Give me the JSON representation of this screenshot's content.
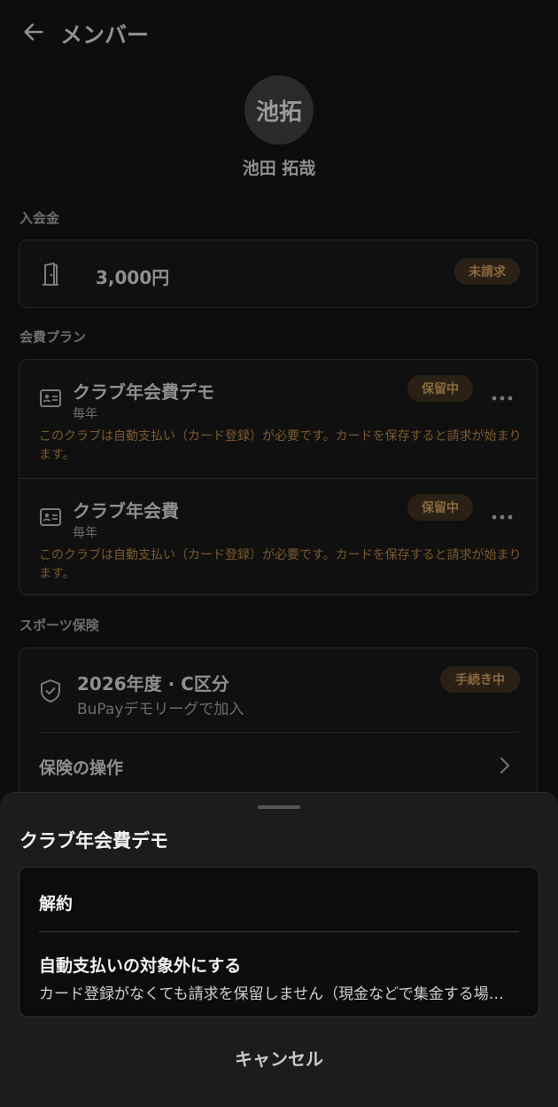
{
  "header": {
    "title": "メンバー"
  },
  "member": {
    "avatar_text": "池拓",
    "name": "池田 拓哉"
  },
  "entry_fee": {
    "label": "入会金",
    "amount": "3,000円",
    "status": "未請求"
  },
  "plans": {
    "label": "会費プラン",
    "items": [
      {
        "name": "クラブ年会費デモ",
        "period": "毎年",
        "status": "保留中",
        "note": "このクラブは自動支払い（カード登録）が必要です。カードを保存すると請求が始まります。"
      },
      {
        "name": "クラブ年会費",
        "period": "毎年",
        "status": "保留中",
        "note": "このクラブは自動支払い（カード登録）が必要です。カードを保存すると請求が始まります。"
      }
    ]
  },
  "insurance": {
    "label": "スポーツ保険",
    "name": "2026年度 · C区分",
    "sub": "BuPayデモリーグで加入",
    "status": "手続き中",
    "operations_label": "保険の操作"
  },
  "sheet": {
    "title": "クラブ年会費デモ",
    "option1": "解約",
    "option2": "自動支払いの対象外にする",
    "option2_sub": "カード登録がなくても請求を保留しません（現金などで集金する場合）",
    "cancel": "キャンセル"
  },
  "colors": {
    "accent_badge_bg": "#2a2116",
    "accent_badge_text": "#8a6a3c",
    "note_text": "#7c5a2a"
  }
}
